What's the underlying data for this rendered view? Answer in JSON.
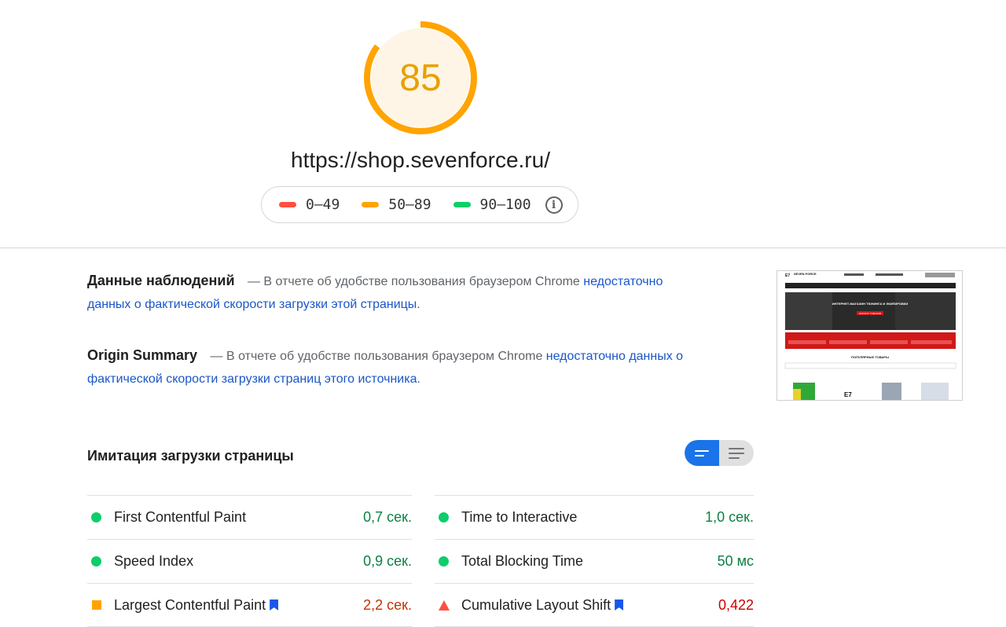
{
  "score": {
    "value": 85,
    "fraction": 0.85,
    "color": "#ffa400"
  },
  "url": "https://shop.sevenforce.ru/",
  "legend": [
    {
      "label": "0–49",
      "color": "#ff4e42"
    },
    {
      "label": "50–89",
      "color": "#ffa400"
    },
    {
      "label": "90–100",
      "color": "#0cce6b"
    }
  ],
  "field_data": {
    "title": "Данные наблюдений",
    "text": "— В отчете об удобстве пользования браузером Chrome",
    "link": "недостаточно данных о фактической скорости загрузки этой страницы",
    "end": "."
  },
  "origin_summary": {
    "title": "Origin Summary",
    "text": "— В отчете об удобстве пользования браузером Chrome",
    "link": "недостаточно данных о фактической скорости загрузки страниц этого источника",
    "end": "."
  },
  "thumbnail": {
    "brand": "SEVEN FORCE",
    "hero": "ИНТЕРНЕТ-МАГАЗИН ТЮНИНГА И ЭКИПИРОВКИ",
    "hero_button": "КАТАЛОГ ТОВАРОВ",
    "section": "ПОПУЛЯРНЫЕ ТОВАРЫ"
  },
  "lab": {
    "title": "Имитация загрузки страницы",
    "left": [
      {
        "name": "First Contentful Paint",
        "value": "0,7 сек.",
        "status": "pass",
        "bookmark": false
      },
      {
        "name": "Speed Index",
        "value": "0,9 сек.",
        "status": "pass",
        "bookmark": false
      },
      {
        "name": "Largest Contentful Paint",
        "value": "2,2 сек.",
        "status": "average",
        "bookmark": true
      }
    ],
    "right": [
      {
        "name": "Time to Interactive",
        "value": "1,0 сек.",
        "status": "pass",
        "bookmark": false
      },
      {
        "name": "Total Blocking Time",
        "value": "50 мс",
        "status": "pass",
        "bookmark": false
      },
      {
        "name": "Cumulative Layout Shift",
        "value": "0,422",
        "status": "fail",
        "bookmark": true
      }
    ]
  }
}
